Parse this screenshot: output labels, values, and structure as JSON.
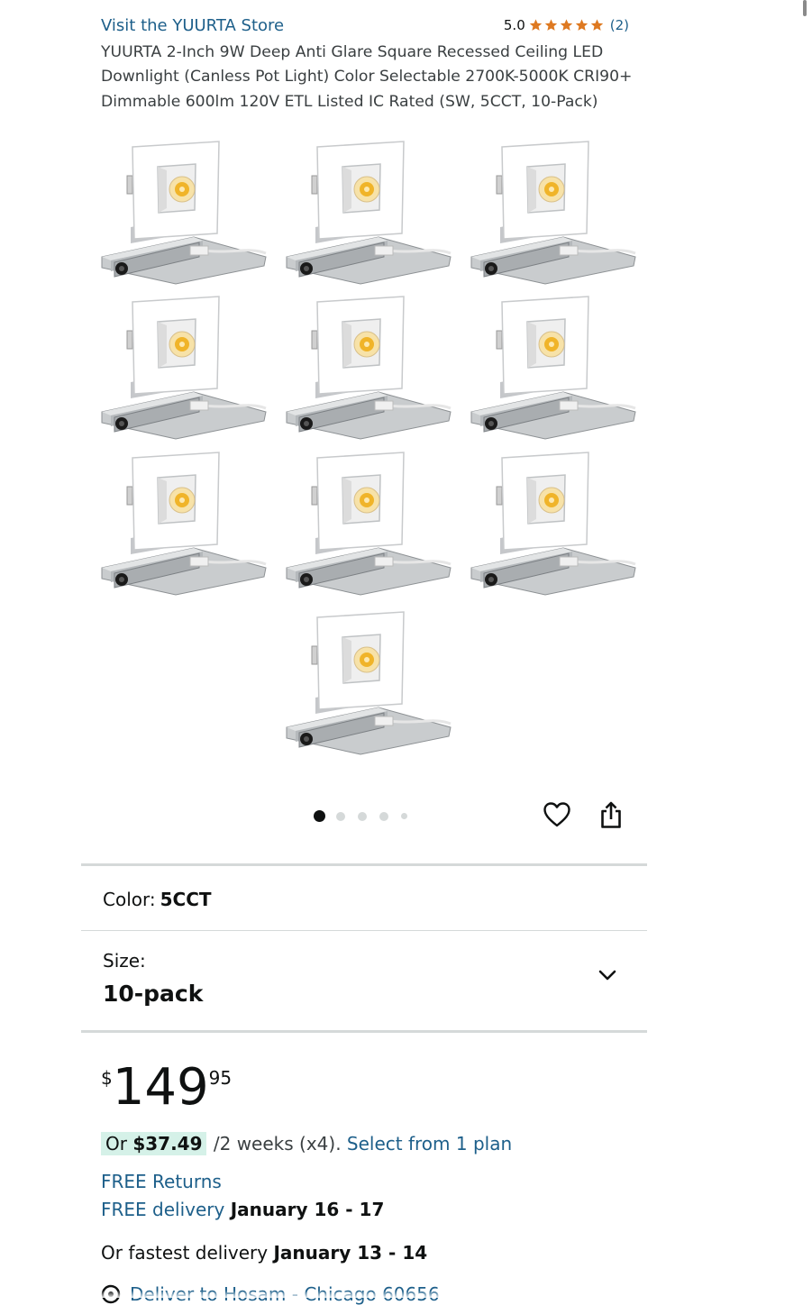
{
  "product": {
    "store_link": "Visit the YUURTA Store",
    "rating_value": "5.0",
    "star_count": 5,
    "rating_count": "(2)",
    "title": "YUURTA 2-Inch 9W Deep Anti Glare Square Recessed Ceiling LED Downlight (Canless Pot Light) Color Selectable 2700K-5000K CRI90+ Dimmable 600lm 120V ETL Listed IC Rated (SW, 5CCT, 10-Pack)"
  },
  "gallery": {
    "item_count": 10,
    "dot_count": 5,
    "active_dot": 0,
    "icons": [
      "heart-icon",
      "share-icon"
    ]
  },
  "variations": {
    "color_label": "Color:",
    "color_value": "5CCT",
    "size_label": "Size:",
    "size_value": "10-pack"
  },
  "price": {
    "symbol": "$",
    "whole": "149",
    "fraction": "95"
  },
  "installments": {
    "prefix": "Or ",
    "amount": "$37.49",
    "terms": "/2 weeks (x4).",
    "link": "Select from 1 plan"
  },
  "delivery": {
    "returns": "FREE Returns",
    "free_delivery_label": "FREE delivery",
    "free_delivery_dates": "January 16 - 17",
    "fastest_label": "Or fastest delivery",
    "fastest_dates": "January 13 - 14",
    "deliver_to": "Deliver to Hosam - Chicago 60656"
  },
  "colors": {
    "link": "#1d5f8a",
    "star": "#de7921",
    "installment_bg": "#d5f1e8"
  }
}
